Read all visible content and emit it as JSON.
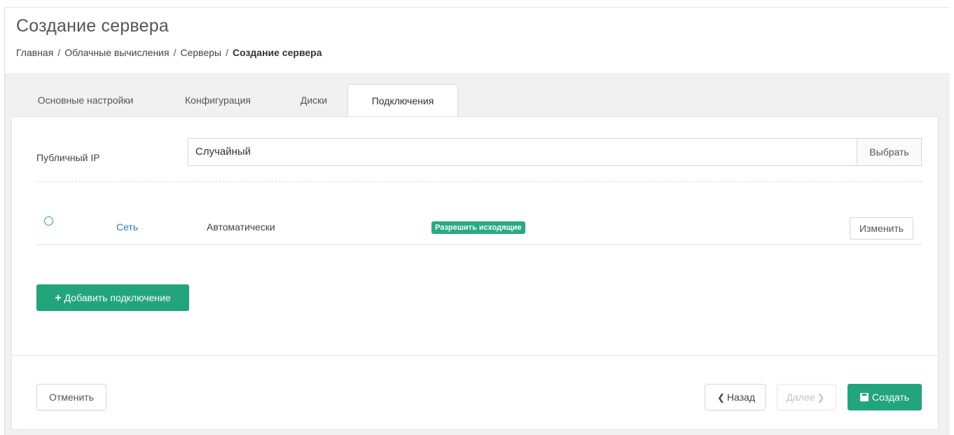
{
  "page": {
    "title": "Создание сервера",
    "breadcrumb": [
      "Главная",
      "Облачные вычисления",
      "Серверы",
      "Создание сервера"
    ]
  },
  "tabs": [
    {
      "label": "Основные настройки",
      "active": false
    },
    {
      "label": "Конфигурация",
      "active": false
    },
    {
      "label": "Диски",
      "active": false
    },
    {
      "label": "Подключения",
      "active": true
    }
  ],
  "public_ip": {
    "label": "Публичный IP",
    "value": "Случайный",
    "select_button": "Выбрать"
  },
  "connection": {
    "network_link": "Сеть",
    "mode": "Автоматически",
    "badge": "Разрешить исходящие",
    "edit_button": "Изменить"
  },
  "add_connection_button": "Добавить подключение",
  "footer": {
    "cancel": "Отменить",
    "back": "Назад",
    "next": "Далее",
    "create": "Создать"
  },
  "colors": {
    "accent": "#23a57c",
    "badge": "#2aaa80",
    "link": "#2a7fc8",
    "background": "#f1f1f1"
  }
}
